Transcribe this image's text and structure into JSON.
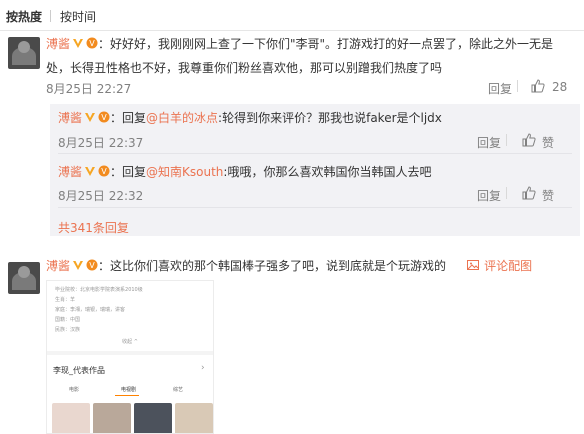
{
  "sort": {
    "hot": "按热度",
    "time": "按时间"
  },
  "comment1": {
    "user": "溥酱",
    "line1": "：好好好，我刚刚网上查了一下你们\"李哥\"。打游戏打的好一点罢了，除此之外一无是",
    "line2": "处，长得丑性格也不好，我尊重你们粉丝喜欢他，那可以别蹭我们热度了吗",
    "time": "8月25日 22:27",
    "reply": "回复",
    "likes": "28"
  },
  "reply1": {
    "user": "溥酱",
    "prefix": "：回复",
    "mention": "@白羊的冰点",
    "text": ":轮得到你来评价？那我也说faker是个ljdx",
    "time": "8月25日 22:37",
    "reply": "回复",
    "like": "赞"
  },
  "reply2": {
    "user": "溥酱",
    "prefix": "：回复",
    "mention": "@知南Ksouth",
    "text": ":哦哦，你那么喜欢韩国你当韩国人去吧",
    "time": "8月25日 22:32",
    "reply": "回复",
    "like": "赞"
  },
  "more_replies": "共341条回复",
  "comment2": {
    "user": "溥酱",
    "text": "：这比你们喜欢的那个韩国棒子强多了吧，说到底就是个玩游戏的",
    "pic_link": "评论配图"
  },
  "image_card": {
    "rows": [
      {
        "label": "毕业院校：",
        "value": "北京电影学院表演系2010级"
      },
      {
        "label": "生肖：",
        "value": "羊"
      },
      {
        "label": "家庭：",
        "value": "李湘，瑞银，瑞瑞，讲客"
      },
      {
        "label": "国籍：",
        "value": "中国"
      },
      {
        "label": "民族：",
        "value": "汉族"
      }
    ],
    "collapse": "收起 ^",
    "works_title": "李现_代表作品",
    "tabs": [
      "电影",
      "电视剧",
      "综艺"
    ]
  },
  "colors": {
    "accent": "#eb7350",
    "text": "#333333",
    "muted": "#808080",
    "reply_bg": "#f2f2f5"
  }
}
